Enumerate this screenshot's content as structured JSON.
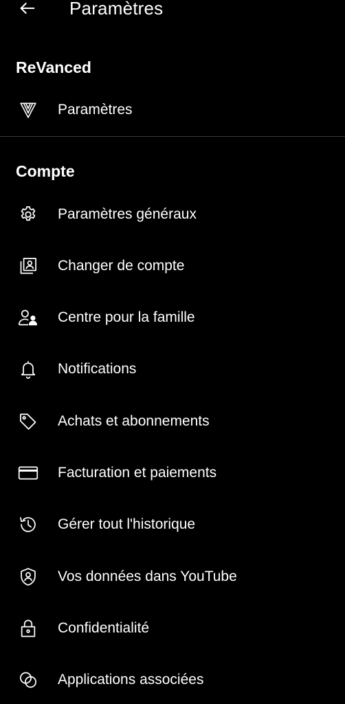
{
  "header": {
    "title": "Paramètres",
    "back_icon": "arrow-left-icon"
  },
  "sections": {
    "revanced": {
      "title": "ReVanced",
      "items": [
        {
          "label": "Paramètres",
          "icon": "revanced-logo-icon"
        }
      ]
    },
    "compte": {
      "title": "Compte",
      "items": [
        {
          "label": "Paramètres généraux",
          "icon": "gear-icon"
        },
        {
          "label": "Changer de compte",
          "icon": "switch-account-icon"
        },
        {
          "label": "Centre pour la famille",
          "icon": "family-icon"
        },
        {
          "label": "Notifications",
          "icon": "bell-icon"
        },
        {
          "label": "Achats et abonnements",
          "icon": "tag-icon"
        },
        {
          "label": "Facturation et paiements",
          "icon": "credit-card-icon"
        },
        {
          "label": "Gérer tout l'historique",
          "icon": "history-icon"
        },
        {
          "label": "Vos données dans YouTube",
          "icon": "shield-person-icon"
        },
        {
          "label": "Confidentialité",
          "icon": "lock-icon"
        },
        {
          "label": "Applications associées",
          "icon": "linked-apps-icon"
        }
      ]
    }
  },
  "colors": {
    "background": "#000000",
    "text": "#ffffff",
    "divider": "#3a3a3a"
  }
}
